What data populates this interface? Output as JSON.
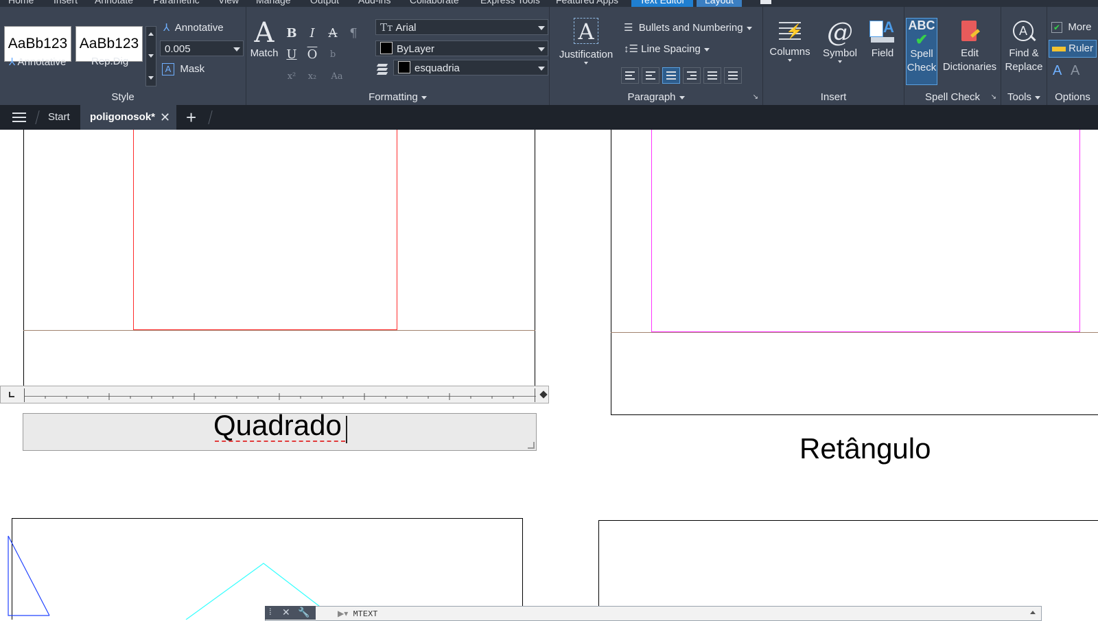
{
  "ribbon_tabs": [
    "Home",
    "Insert",
    "Annotate",
    "Parametric",
    "View",
    "Manage",
    "Output",
    "Add-ins",
    "Collaborate",
    "Express Tools",
    "Featured Apps",
    "Text Editor",
    "Layout"
  ],
  "style_panel": {
    "style1": "AaBb123",
    "style1_label": "Annotative",
    "style2": "AaBb123",
    "style2_label": "Rep.Dig",
    "annotative_label": "Annotative",
    "height_value": "0.005",
    "mask_label": "Mask",
    "title": "Style"
  },
  "formatting_panel": {
    "match_label": "Match",
    "font": "Arial",
    "color": "ByLayer",
    "layer": "esquadria",
    "title": "Formatting"
  },
  "paragraph_panel": {
    "justification_label": "Justification",
    "bullets_label": "Bullets and Numbering",
    "line_spacing_label": "Line Spacing",
    "title": "Paragraph"
  },
  "insert_panel": {
    "columns_label": "Columns",
    "symbol_label": "Symbol",
    "field_label": "Field",
    "title": "Insert"
  },
  "spell_panel": {
    "spell_check_label1": "Spell",
    "spell_check_label2": "Check",
    "edit_dict_label1": "Edit",
    "edit_dict_label2": "Dictionaries",
    "title": "Spell Check"
  },
  "tools_panel": {
    "find_label1": "Find &",
    "find_label2": "Replace",
    "title": "Tools"
  },
  "options_panel": {
    "more_label": "More",
    "ruler_label": "Ruler",
    "title": "Options"
  },
  "doc_tabs": {
    "start": "Start",
    "active": "poligonosok*"
  },
  "drawing": {
    "editor_text": "Quadrado",
    "label_rectangle": "Retângulo"
  },
  "command_line": {
    "text": "MTEXT"
  },
  "colors": {
    "ribbon_bg": "#3b4453",
    "accent": "#1f7fd1",
    "square_line": "#ff2a2a",
    "rect_line": "#ff33ff",
    "cyan_line": "#33ffff",
    "blue_line": "#2244ff"
  }
}
